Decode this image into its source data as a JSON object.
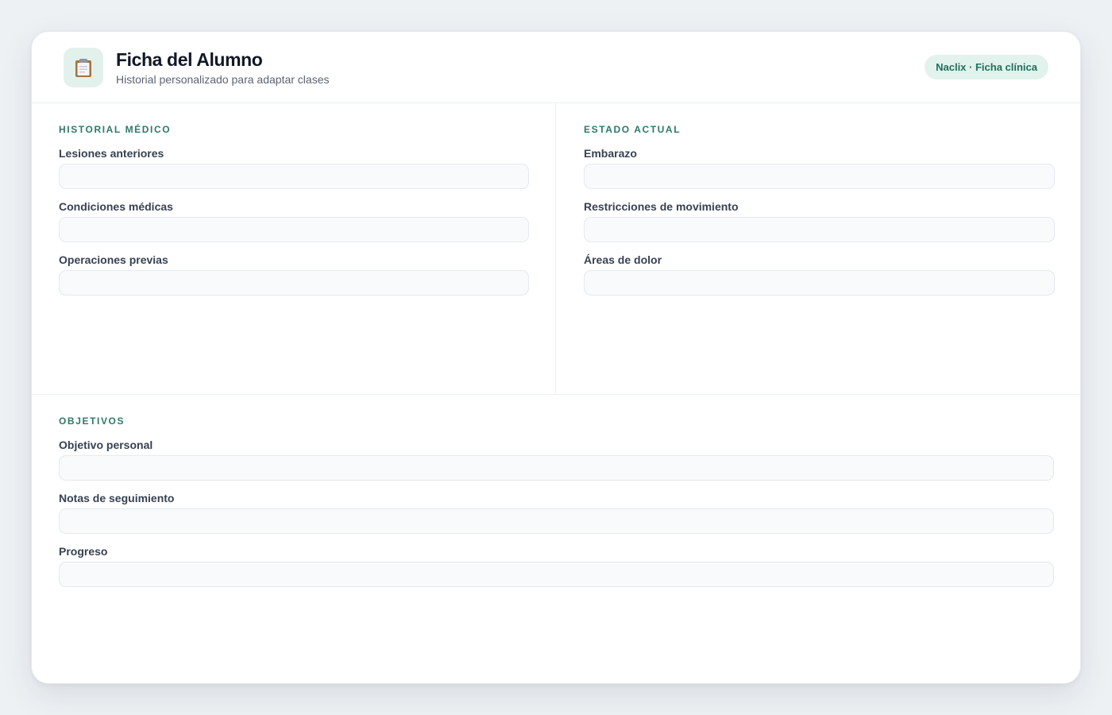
{
  "header": {
    "title": "Ficha del Alumno",
    "subtitle": "Historial personalizado para adaptar clases",
    "badge": "Naclix · Ficha clínica",
    "logo_icon": "clipboard-icon"
  },
  "sections": {
    "medical": {
      "title": "Historial médico",
      "fields": [
        {
          "label": "Lesiones anteriores",
          "value": "",
          "placeholder": ""
        },
        {
          "label": "Condiciones médicas",
          "value": "",
          "placeholder": ""
        },
        {
          "label": "Operaciones previas",
          "value": "",
          "placeholder": ""
        }
      ]
    },
    "status": {
      "title": "Estado actual",
      "fields": [
        {
          "label": "Embarazo",
          "value": "",
          "placeholder": ""
        },
        {
          "label": "Restricciones de movimiento",
          "value": "",
          "placeholder": ""
        },
        {
          "label": "Áreas de dolor",
          "value": "",
          "placeholder": ""
        }
      ]
    },
    "goals": {
      "title": "Objetivos",
      "fields": [
        {
          "label": "Objetivo personal",
          "value": "",
          "placeholder": ""
        },
        {
          "label": "Notas de seguimiento",
          "value": "",
          "placeholder": ""
        },
        {
          "label": "Progreso",
          "value": "",
          "placeholder": ""
        }
      ]
    }
  },
  "colors": {
    "accent": "#2b7a68",
    "badge_bg": "#e2f2ec",
    "input_bg": "#f8fafb",
    "page_bg": "#eef1f4"
  }
}
